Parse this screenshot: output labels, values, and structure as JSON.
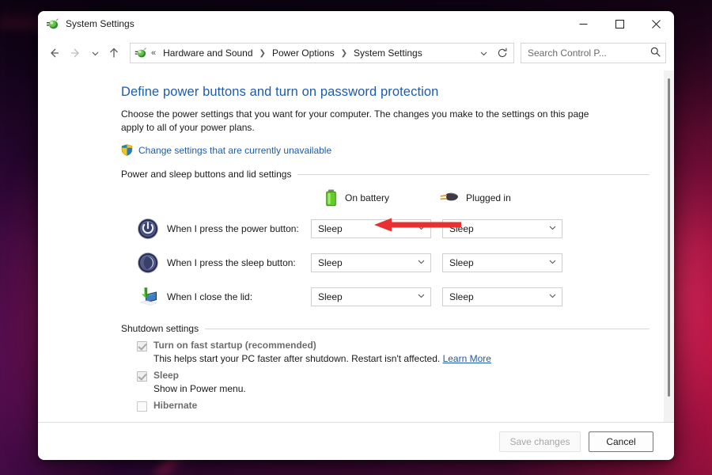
{
  "window": {
    "title": "System Settings",
    "icon": "system-settings-icon",
    "minimize_label": "—",
    "maximize_label": "□",
    "close_label": "✕"
  },
  "toolbar": {
    "back_label": "←",
    "forward_label": "→",
    "recent_label": "⌄",
    "up_label": "↑",
    "address_icon": "system-settings-icon",
    "address_prefix": "«",
    "breadcrumbs": [
      {
        "label": "Hardware and Sound"
      },
      {
        "label": "Power Options"
      },
      {
        "label": "System Settings"
      }
    ],
    "breadcrumb_separator": "❯",
    "dropdown_label": "⌄",
    "refresh_label": "⟳",
    "search": {
      "placeholder": "Search Control P...",
      "value": "",
      "icon": "search-icon"
    }
  },
  "page": {
    "title": "Define power buttons and turn on password protection",
    "description": "Choose the power settings that you want for your computer. The changes you make to the settings on this page apply to all of your power plans.",
    "uac_link": "Change settings that are currently unavailable",
    "uac_icon": "uac-shield-icon"
  },
  "power_section": {
    "heading": "Power and sleep buttons and lid settings",
    "columns": [
      {
        "label": "On battery",
        "icon": "battery-icon"
      },
      {
        "label": "Plugged in",
        "icon": "power-plug-icon"
      }
    ],
    "rows": [
      {
        "icon": "power-button-icon",
        "label": "When I press the power button:",
        "on_battery": "Sleep",
        "plugged_in": "Sleep"
      },
      {
        "icon": "sleep-button-icon",
        "label": "When I press the sleep button:",
        "on_battery": "Sleep",
        "plugged_in": "Sleep"
      },
      {
        "icon": "laptop-lid-icon",
        "label": "When I close the lid:",
        "on_battery": "Sleep",
        "plugged_in": "Sleep"
      }
    ],
    "combo_chevron": "⌄"
  },
  "shutdown_section": {
    "heading": "Shutdown settings",
    "items": [
      {
        "label": "Turn on fast startup (recommended)",
        "checked": true,
        "disabled": true,
        "sub_text": "This helps start your PC faster after shutdown. Restart isn't affected.",
        "link_text": "Learn More"
      },
      {
        "label": "Sleep",
        "checked": true,
        "disabled": true,
        "sub_text": "Show in Power menu.",
        "link_text": ""
      },
      {
        "label": "Hibernate",
        "checked": false,
        "disabled": true,
        "sub_text": "",
        "link_text": ""
      }
    ]
  },
  "footer": {
    "save_label": "Save changes",
    "save_disabled": true,
    "cancel_label": "Cancel"
  },
  "annotation": {
    "type": "red-arrow-left",
    "color": "#e83030"
  },
  "colors": {
    "link": "#1f5ca8",
    "heading": "#1f5ca8",
    "accent_red": "#e83030",
    "battery_green": "#54c226"
  }
}
